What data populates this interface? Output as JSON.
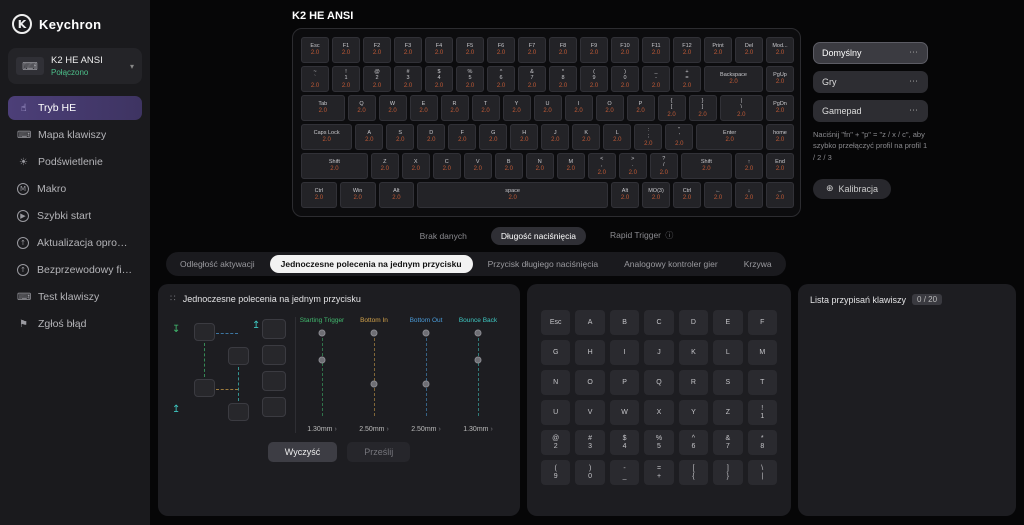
{
  "colors": {
    "accent_purple": "#4a3d72",
    "value_orange": "#c05a36",
    "connected_green": "#4cbf8a",
    "trigger_start": "#41b96e",
    "trigger_bottom_in": "#d2a24a",
    "trigger_bottom_out": "#4a9bd8",
    "trigger_bounce_back": "#3ec6c0"
  },
  "sidebar": {
    "brand": "Keychron",
    "device": {
      "name": "K2 HE ANSI",
      "status": "Połączono"
    },
    "items": [
      {
        "label": "Tryb HE",
        "icon": "hand-tap-icon",
        "active": true
      },
      {
        "label": "Mapa klawiszy",
        "icon": "keymap-icon"
      },
      {
        "label": "Podświetlenie",
        "icon": "backlight-icon"
      },
      {
        "label": "Makro",
        "icon": "macro-icon"
      },
      {
        "label": "Szybki start",
        "icon": "quick-start-icon"
      },
      {
        "label": "Aktualizacja oprogram...",
        "icon": "firmware-update-icon"
      },
      {
        "label": "Bezprzewodowy firmwa...",
        "icon": "wireless-firmware-icon"
      },
      {
        "label": "Test klawiszy",
        "icon": "key-test-icon"
      },
      {
        "label": "Zgłoś błąd",
        "icon": "report-bug-icon"
      }
    ]
  },
  "header": {
    "title": "K2 HE ANSI"
  },
  "keyboard": {
    "key_value": "2.0",
    "rows": [
      [
        {
          "l": "Esc"
        },
        {
          "l": "F1"
        },
        {
          "l": "F2"
        },
        {
          "l": "F3"
        },
        {
          "l": "F4"
        },
        {
          "l": "F5"
        },
        {
          "l": "F6"
        },
        {
          "l": "F7"
        },
        {
          "l": "F8"
        },
        {
          "l": "F9"
        },
        {
          "l": "F10"
        },
        {
          "l": "F11"
        },
        {
          "l": "F12"
        },
        {
          "l": "Print"
        },
        {
          "l": "Del"
        },
        {
          "l": "Mod..."
        }
      ],
      [
        {
          "l": "~\n`"
        },
        {
          "l": "!\n1"
        },
        {
          "l": "@\n2"
        },
        {
          "l": "#\n3"
        },
        {
          "l": "$\n4"
        },
        {
          "l": "%\n5"
        },
        {
          "l": "^\n6"
        },
        {
          "l": "&\n7"
        },
        {
          "l": "*\n8"
        },
        {
          "l": "(\n9"
        },
        {
          "l": ")\n0"
        },
        {
          "l": "_\n-"
        },
        {
          "l": "+\n="
        },
        {
          "l": "Backspace",
          "w": 2
        },
        {
          "l": "PgUp"
        }
      ],
      [
        {
          "l": "Tab",
          "w": 1.5
        },
        {
          "l": "Q"
        },
        {
          "l": "W"
        },
        {
          "l": "E"
        },
        {
          "l": "R"
        },
        {
          "l": "T"
        },
        {
          "l": "Y"
        },
        {
          "l": "U"
        },
        {
          "l": "I"
        },
        {
          "l": "O"
        },
        {
          "l": "P"
        },
        {
          "l": "{\n["
        },
        {
          "l": "}\n]"
        },
        {
          "l": "|\n\\",
          "w": 1.5
        },
        {
          "l": "PgDn"
        }
      ],
      [
        {
          "l": "Caps Lock",
          "w": 1.75
        },
        {
          "l": "A"
        },
        {
          "l": "S"
        },
        {
          "l": "D"
        },
        {
          "l": "F"
        },
        {
          "l": "G"
        },
        {
          "l": "H"
        },
        {
          "l": "J"
        },
        {
          "l": "K"
        },
        {
          "l": "L"
        },
        {
          "l": ":\n;"
        },
        {
          "l": "\"\n'"
        },
        {
          "l": "Enter",
          "w": 2.25
        },
        {
          "l": "home"
        }
      ],
      [
        {
          "l": "Shift",
          "w": 2.25
        },
        {
          "l": "Z"
        },
        {
          "l": "X"
        },
        {
          "l": "C"
        },
        {
          "l": "V"
        },
        {
          "l": "B"
        },
        {
          "l": "N"
        },
        {
          "l": "M"
        },
        {
          "l": "<\n,"
        },
        {
          "l": ">\n."
        },
        {
          "l": "?\n/"
        },
        {
          "l": "Shift",
          "w": 1.75
        },
        {
          "l": "↑"
        },
        {
          "l": "End"
        }
      ],
      [
        {
          "l": "Ctrl",
          "w": 1.25
        },
        {
          "l": "Win",
          "w": 1.25
        },
        {
          "l": "Alt",
          "w": 1.25
        },
        {
          "l": "space",
          "w": 6.25
        },
        {
          "l": "Alt"
        },
        {
          "l": "MO(3)"
        },
        {
          "l": "Ctrl"
        },
        {
          "l": "←"
        },
        {
          "l": "↓"
        },
        {
          "l": "→"
        }
      ]
    ]
  },
  "profiles": {
    "items": [
      {
        "label": "Domyślny",
        "selected": true
      },
      {
        "label": "Gry"
      },
      {
        "label": "Gamepad"
      }
    ],
    "menu_icon": "⋯",
    "hint": "Naciśnij \"fn\" + \"p\" = \"z / x / c\", aby szybko przełączyć profil na profil 1 / 2 / 3",
    "calibration_label": "Kalibracja"
  },
  "display_modes": {
    "options": [
      {
        "label": "Brak danych"
      },
      {
        "label": "Długość naciśnięcia",
        "selected": true
      },
      {
        "label": "Rapid Trigger",
        "info": true
      }
    ]
  },
  "tabs": [
    {
      "label": "Odległość aktywacji"
    },
    {
      "label": "Jednoczesne polecenia na jednym przycisku",
      "selected": true
    },
    {
      "label": "Przycisk długiego naciśnięcia"
    },
    {
      "label": "Analogowy kontroler gier"
    },
    {
      "label": "Krzywa"
    }
  ],
  "dks_panel": {
    "title": "Jednoczesne polecenia na jednym przycisku",
    "travel_max_mm": 4.0,
    "triggers": [
      {
        "label": "Starting Trigger",
        "value": "1.30mm",
        "color": "#41b96e"
      },
      {
        "label": "Bottom In",
        "value": "2.50mm",
        "color": "#d2a24a"
      },
      {
        "label": "Bottom Out",
        "value": "2.50mm",
        "color": "#4a9bd8"
      },
      {
        "label": "Bounce Back",
        "value": "1.30mm",
        "color": "#3ec6c0"
      }
    ],
    "clear_label": "Wyczyść",
    "submit_label": "Prześlij"
  },
  "key_picker": {
    "rows": [
      [
        "Esc",
        "A",
        "B",
        "C",
        "D",
        "E",
        "F"
      ],
      [
        "G",
        "H",
        "I",
        "J",
        "K",
        "L",
        "M"
      ],
      [
        "N",
        "O",
        "P",
        "Q",
        "R",
        "S",
        "T"
      ],
      [
        "U",
        "V",
        "W",
        "X",
        "Y",
        "Z",
        "!\n1"
      ],
      [
        "@\n2",
        "#\n3",
        "$\n4",
        "%\n5",
        "^\n6",
        "&\n7",
        "*\n8"
      ],
      [
        "(\n9",
        ")\n0",
        "-\n_",
        "=\n+",
        "[\n{",
        "]\n}",
        "\\\n|"
      ]
    ]
  },
  "assignments": {
    "title": "Lista przypisań klawiszy",
    "count": "0 / 20"
  }
}
